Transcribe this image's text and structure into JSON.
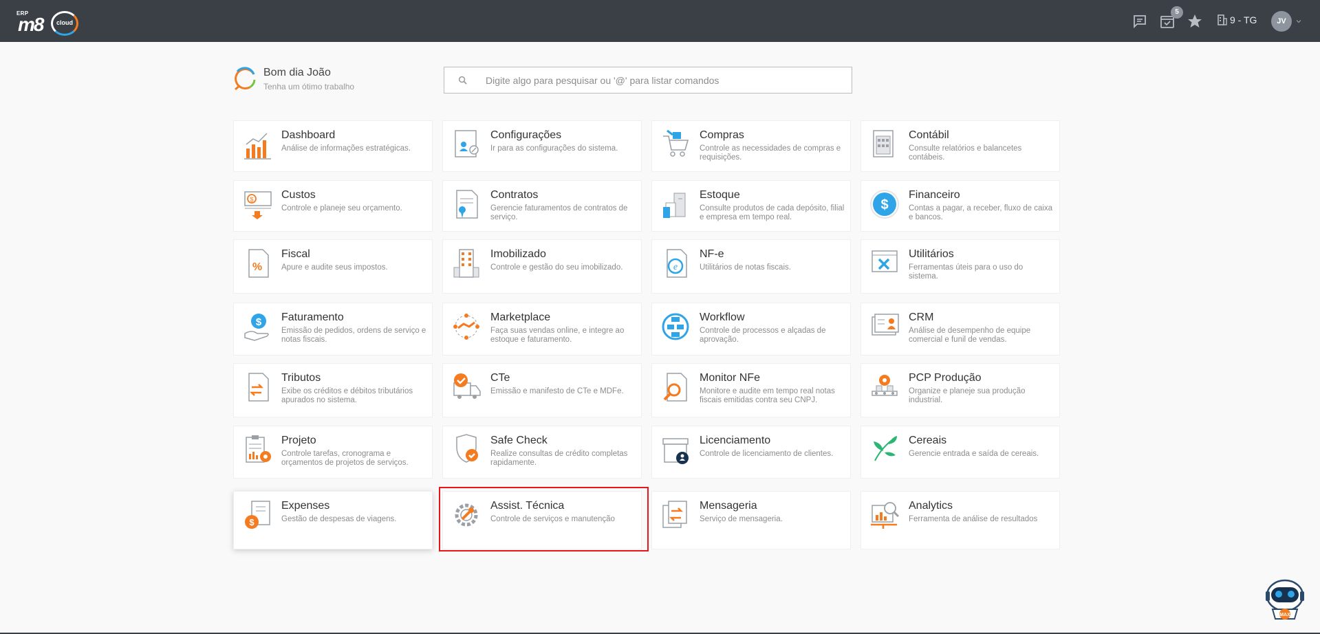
{
  "header": {
    "logo_erp": "ERP",
    "logo_m8": "m8",
    "logo_cloud": "cloud",
    "notification_count": "5",
    "company": "9 - TG",
    "user_initials": "JV"
  },
  "greeting": {
    "title": "Bom dia João",
    "subtitle": "Tenha um ótimo trabalho"
  },
  "search": {
    "placeholder": "Digite algo para pesquisar ou '@' para listar comandos"
  },
  "modules": [
    {
      "title": "Dashboard",
      "desc": "Análise de informações estratégicas.",
      "icon": "dashboard-icon"
    },
    {
      "title": "Configurações",
      "desc": "Ir para as configurações do sistema.",
      "icon": "settings-icon"
    },
    {
      "title": "Compras",
      "desc": "Controle as necessidades de compras e requisições.",
      "icon": "cart-icon"
    },
    {
      "title": "Contábil",
      "desc": "Consulte relatórios e balancetes contábeis.",
      "icon": "calculator-icon"
    },
    {
      "title": "Custos",
      "desc": "Controle e planeje seu orçamento.",
      "icon": "costs-icon"
    },
    {
      "title": "Contratos",
      "desc": "Gerencie faturamentos de contratos de serviço.",
      "icon": "contract-icon"
    },
    {
      "title": "Estoque",
      "desc": "Consulte produtos de cada depósito, filial e empresa em tempo real.",
      "icon": "warehouse-icon"
    },
    {
      "title": "Financeiro",
      "desc": "Contas a pagar, a receber, fluxo de caixa e bancos.",
      "icon": "dollar-icon"
    },
    {
      "title": "Fiscal",
      "desc": "Apure e audite seus impostos.",
      "icon": "percent-icon"
    },
    {
      "title": "Imobilizado",
      "desc": "Controle e gestão do seu imobilizado.",
      "icon": "building-icon"
    },
    {
      "title": "NF-e",
      "desc": "Utilitários de notas fiscais.",
      "icon": "nfe-icon"
    },
    {
      "title": "Utilitários",
      "desc": "Ferramentas úteis para o uso do sistema.",
      "icon": "tools-icon"
    },
    {
      "title": "Faturamento",
      "desc": "Emissão de pedidos, ordens de serviço e notas fiscais.",
      "icon": "invoice-hand-icon"
    },
    {
      "title": "Marketplace",
      "desc": "Faça suas vendas online, e integre ao estoque e faturamento.",
      "icon": "handshake-icon"
    },
    {
      "title": "Workflow",
      "desc": "Controle de processos e alçadas de aprovação.",
      "icon": "workflow-icon"
    },
    {
      "title": "CRM",
      "desc": "Análise de desempenho de equipe comercial e funil de vendas.",
      "icon": "crm-icon"
    },
    {
      "title": "Tributos",
      "desc": "Exibe os créditos e débitos tributários apurados no sistema.",
      "icon": "transfer-doc-icon"
    },
    {
      "title": "CTe",
      "desc": "Emissão e manifesto de CTe e MDFe.",
      "icon": "truck-icon"
    },
    {
      "title": "Monitor NFe",
      "desc": "Monitore e audite em tempo real notas fiscais emitidas contra seu CNPJ.",
      "icon": "magnifier-doc-icon"
    },
    {
      "title": "PCP Produção",
      "desc": "Organize e planeje sua produção industrial.",
      "icon": "production-icon"
    },
    {
      "title": "Projeto",
      "desc": "Controle tarefas, cronograma e orçamentos de projetos de serviços.",
      "icon": "project-icon"
    },
    {
      "title": "Safe Check",
      "desc": "Realize consultas de crédito completas rapidamente.",
      "icon": "shield-check-icon"
    },
    {
      "title": "Licenciamento",
      "desc": "Controle de licenciamento de clientes.",
      "icon": "license-icon"
    },
    {
      "title": "Cereais",
      "desc": "Gerencie entrada e saída de cereais.",
      "icon": "leaf-icon"
    },
    {
      "title": "Expenses",
      "desc": "Gestão de despesas de viagens.",
      "icon": "expenses-icon"
    },
    {
      "title": "Assist. Técnica",
      "desc": "Controle de serviços e manutenção",
      "icon": "wrench-gear-icon"
    },
    {
      "title": "Mensageria",
      "desc": "Serviço de mensageria.",
      "icon": "messaging-icon"
    },
    {
      "title": "Analytics",
      "desc": "Ferramenta de análise de resultados",
      "icon": "analytics-icon"
    }
  ],
  "bot_label": "MAX"
}
